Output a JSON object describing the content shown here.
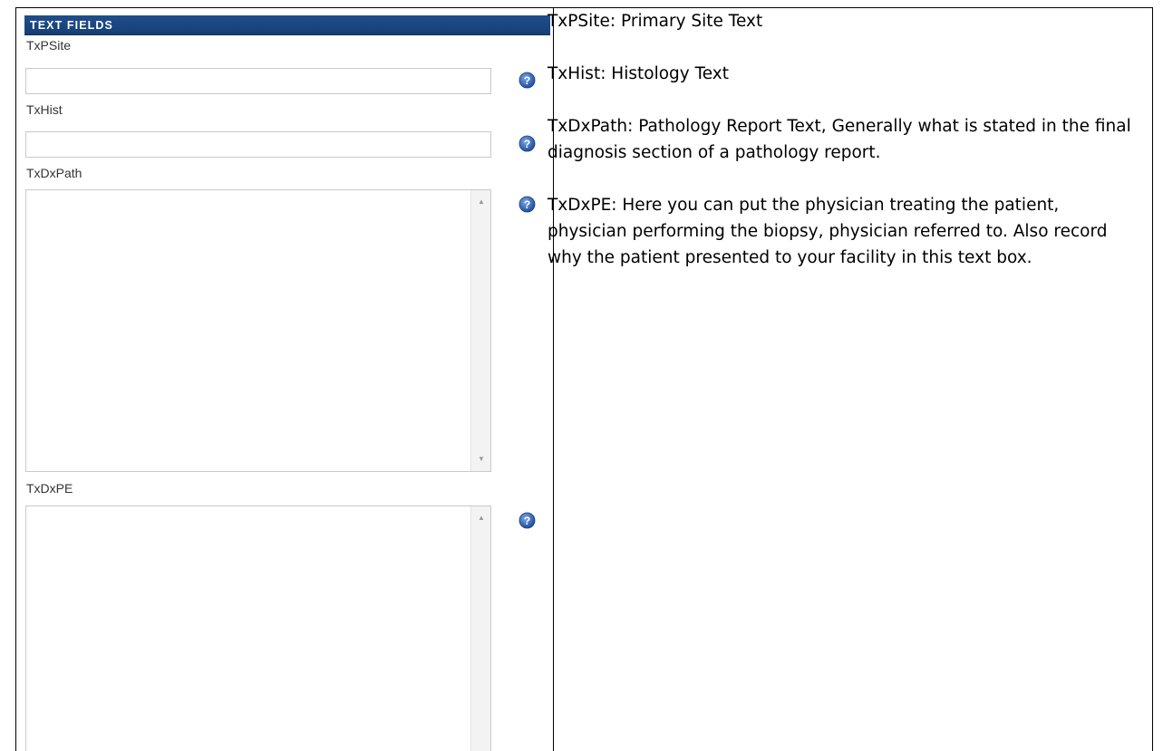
{
  "section": {
    "title": "TEXT FIELDS"
  },
  "fields": {
    "txpsite": {
      "label": "TxPSite",
      "value": ""
    },
    "txhist": {
      "label": "TxHist",
      "value": ""
    },
    "txdxpath": {
      "label": "TxDxPath",
      "value": ""
    },
    "txdxpe": {
      "label": "TxDxPE",
      "value": ""
    }
  },
  "icons": {
    "help": "question-mark-help-icon",
    "scroll_up": "triangle-up",
    "scroll_down": "triangle-down"
  },
  "colors": {
    "header_bg": "#1f4e8c",
    "header_text": "#ffffff",
    "help_icon": "#2b5ea8"
  },
  "descriptions": {
    "txpsite": "TxPSite: Primary Site Text",
    "txhist": "TxHist:  Histology Text",
    "txdxpath": "TxDxPath:  Pathology Report Text,  Generally what is stated in the final diagnosis section of a pathology report.",
    "txdxpe": "TxDxPE:  Here you can put the physician treating the patient, physician performing the biopsy, physician referred to.  Also record why the patient presented to your facility in this text box."
  }
}
